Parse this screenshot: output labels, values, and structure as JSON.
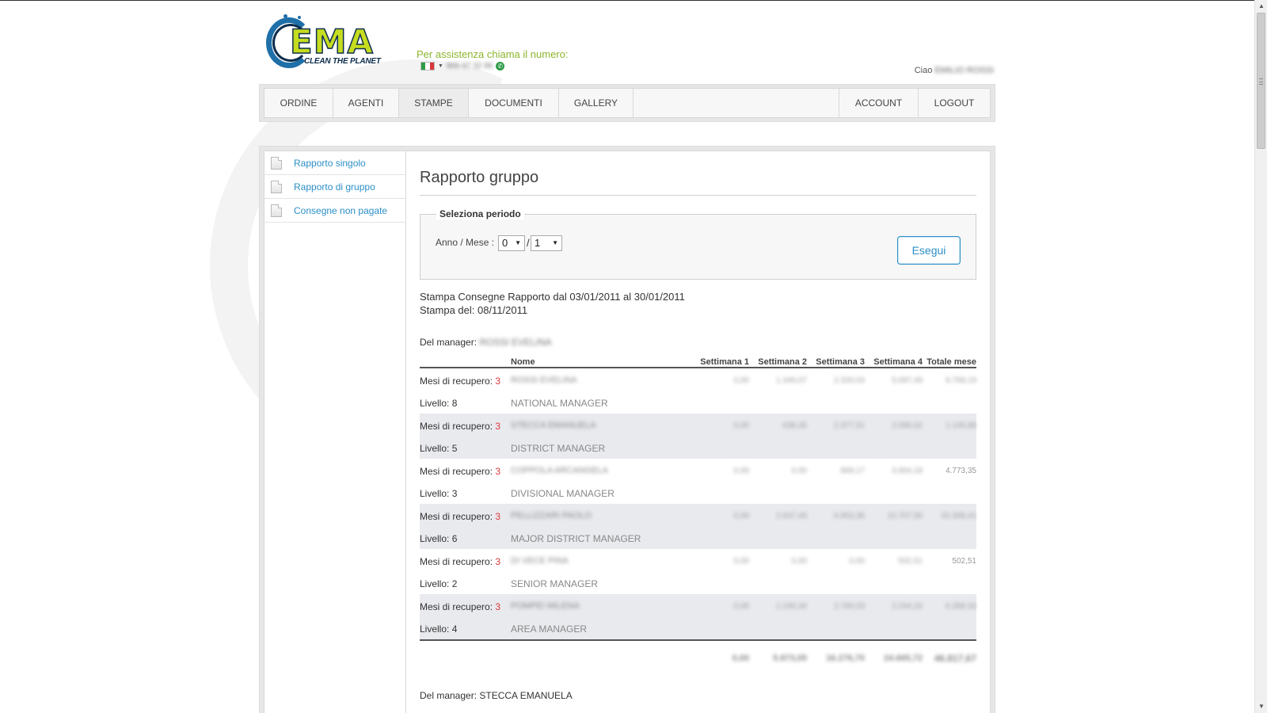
{
  "header": {
    "logo_text": "EMA",
    "logo_tagline": "CLEAN THE PLANET",
    "assistance_label": "Per assistenza chiama il numero:",
    "phone_number": "800 97 32 86",
    "greeting": "Ciao",
    "user_name": "EMILIO ROSSI"
  },
  "nav": {
    "items": [
      "ORDINE",
      "AGENTI",
      "STAMPE",
      "DOCUMENTI",
      "GALLERY"
    ],
    "right_items": [
      "ACCOUNT",
      "LOGOUT"
    ]
  },
  "sidebar": {
    "items": [
      {
        "label": "Rapporto singolo"
      },
      {
        "label": "Rapporto di gruppo"
      },
      {
        "label": "Consegne non pagate"
      }
    ]
  },
  "main": {
    "title": "Rapporto gruppo",
    "period_legend": "Seleziona periodo",
    "period_label": "Anno /  Mese :",
    "year_value": "0",
    "month_value": "1",
    "separator": "/",
    "run_button": "Esegui",
    "report_range": "Stampa Consegne Rapporto dal 03/01/2011 al 30/01/2011",
    "print_date": "Stampa del: 08/11/2011",
    "manager_label": "Del manager:",
    "manager_name": "ROSSI EVELINA",
    "second_manager": "Del manager: STECCA EMANUELA"
  },
  "table": {
    "headers": {
      "name": "Nome",
      "w1": "Settimana 1",
      "w2": "Settimana 2",
      "w3": "Settimana 3",
      "w4": "Settimana 4",
      "total": "Totale mese"
    },
    "recovery_label": "Mesi di recupero:",
    "rows": [
      {
        "recovery": "3",
        "level": "Livello: 8",
        "name": "ROSSI EVELINA",
        "role": "NATIONAL MANAGER",
        "w1": "0,00",
        "w2": "1.340,07",
        "w3": "2.320,03",
        "w4": "5.097,49",
        "total": "9.769,19"
      },
      {
        "recovery": "3",
        "level": "Livello: 5",
        "name": "STECCA EMANUELA",
        "role": "DISTRICT MANAGER",
        "w1": "0,00",
        "w2": "638,35",
        "w3": "2.377,51",
        "w4": "2.090,02",
        "total": "1.105,88"
      },
      {
        "recovery": "3",
        "level": "Livello: 3",
        "name": "COPPOLA ARCANGELA",
        "role": "DIVISIONAL MANAGER",
        "w1": "0,00",
        "w2": "0,00",
        "w3": "869,17",
        "w4": "3.904,18",
        "total": "4.773,35"
      },
      {
        "recovery": "3",
        "level": "Livello: 6",
        "name": "PELLIZZARI PAOLO",
        "role": "MAJOR DISTRICT MANAGER",
        "w1": "0,00",
        "w2": "2.647,49",
        "w3": "6.953,36",
        "w4": "10.707,56",
        "total": "20.308,41"
      },
      {
        "recovery": "3",
        "level": "Livello: 2",
        "name": "DI VECE PINA",
        "role": "SENIOR MANAGER",
        "w1": "0,00",
        "w2": "0,00",
        "w3": "0,00",
        "w4": "502,51",
        "total": "502,51"
      },
      {
        "recovery": "3",
        "level": "Livello: 4",
        "name": "POMPEI MILENA",
        "role": "AREA MANAGER",
        "w1": "0,00",
        "w2": "1.240,34",
        "w3": "2.760,03",
        "w4": "2.244,16",
        "total": "6.358,33"
      }
    ],
    "totals": {
      "w1": "0,00",
      "w2": "5.873,05",
      "w3": "16.276,70",
      "w4": "24.665,72",
      "total": "46.817,67"
    }
  },
  "colors": {
    "accent": "#2b8fc7",
    "assist_green": "#8db52d",
    "recovery_red": "#d9383a",
    "logo_green": "#c6dc1f",
    "logo_blue": "#1f6fa8"
  }
}
